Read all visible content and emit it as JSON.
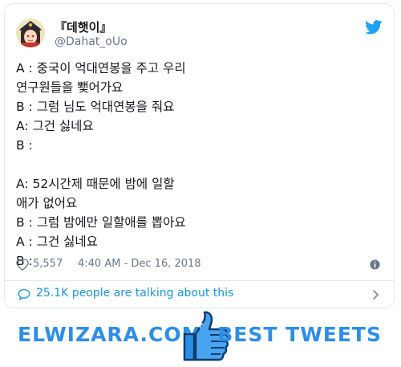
{
  "tweet": {
    "display_name": "『데햇이』",
    "handle": "@Dahat_oUo",
    "lines": [
      "A : 중국이 억대연봉을 주고 우리",
      "연구원들을 뾏어가요",
      "B : 그럼 님도 억대연봉을 줘요",
      "A: 그건 싫네요",
      "B :",
      "",
      "A: 52시간제 때문에 밤에 일할",
      "애가 없어요",
      "B : 그럼 밤에만 일할애를 뽑아요",
      "A : 그건 싫네요",
      "B :"
    ],
    "like_count": "5,557",
    "timestamp": "4:40 AM - Dec 16, 2018",
    "talking": "25.1K people are talking about this"
  },
  "brand": {
    "left": "ELWIZARA.COM",
    "right": "BEST TWEETS"
  },
  "icons": {
    "twitter": "twitter-bird-icon",
    "like": "heart-icon",
    "info": "info-icon",
    "chat": "chat-bubble-icon",
    "chevron": "chevron-right-icon",
    "thumb": "thumbs-up-icon"
  },
  "colors": {
    "twitter_blue": "#1da1f2",
    "link_blue": "#1b95e0",
    "muted": "#657786",
    "brand_blue": "#2d8ee8"
  }
}
